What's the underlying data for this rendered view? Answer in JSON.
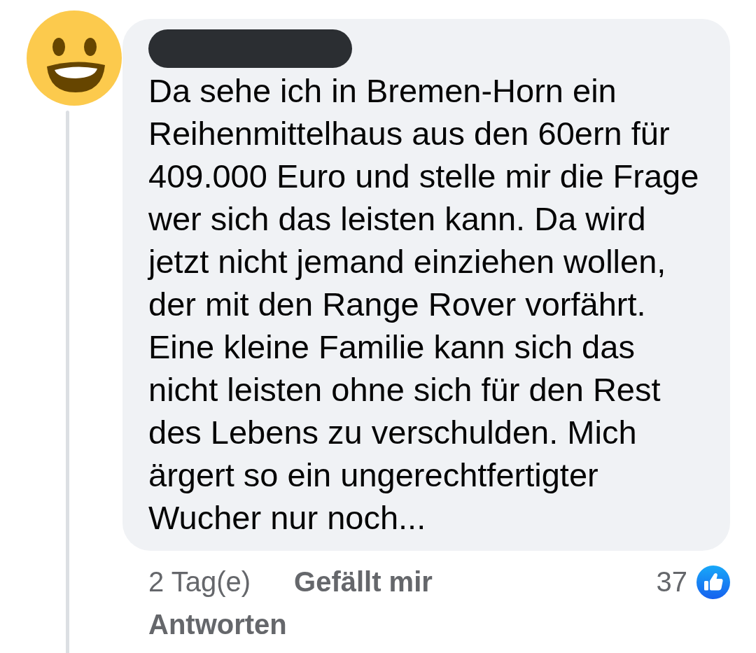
{
  "comment": {
    "name_redacted": true,
    "text": "Da sehe ich in Bremen-Horn ein Reihenmittelhaus aus den 60ern für 409.000 Euro und stelle mir die Frage wer sich das leisten kann. Da wird jetzt nicht jemand einziehen wollen, der mit den Range Rover vorfährt. Eine kleine Familie kann sich das nicht leisten ohne sich für den Rest des Lebens zu verschulden. Mich ärgert so ein ungerechtfertigter Wucher nur noch...",
    "time": "2 Tag(e)",
    "actions": [
      {
        "label": "Gefällt mir"
      },
      {
        "label": "Antworten"
      }
    ],
    "reactions": {
      "count": "37"
    }
  }
}
